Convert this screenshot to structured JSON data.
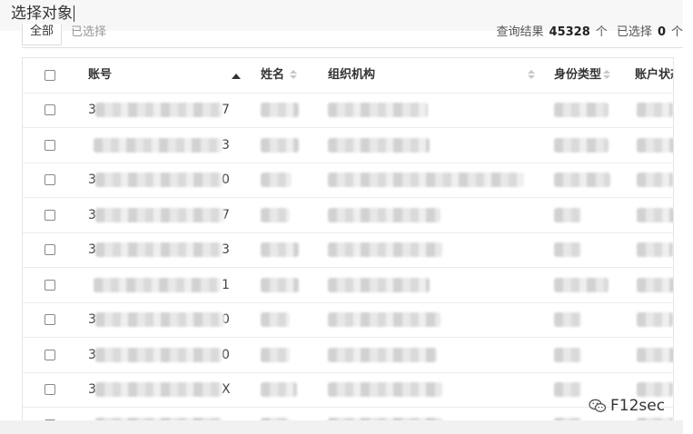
{
  "dialog": {
    "title": "选择对象"
  },
  "filter": {
    "tab_all": "全部",
    "selected_placeholder": "已选择",
    "result_label": "查询结果",
    "result_count": "45328",
    "unit": "个",
    "selected_label": "已选择",
    "selected_count": "0",
    "unit2": "个"
  },
  "table": {
    "columns": [
      "账号",
      "姓名",
      "组织机构",
      "身份类型",
      "账户状态"
    ],
    "rows": [
      {
        "account_lead": "3",
        "account_tail": "7"
      },
      {
        "account_lead": "",
        "account_tail": "3"
      },
      {
        "account_lead": "3",
        "account_tail": "0"
      },
      {
        "account_lead": "3",
        "account_tail": "7"
      },
      {
        "account_lead": "3",
        "account_tail": "3"
      },
      {
        "account_lead": "",
        "account_tail": "1"
      },
      {
        "account_lead": "3",
        "account_tail": "0"
      },
      {
        "account_lead": "3",
        "account_tail": "0"
      },
      {
        "account_lead": "3",
        "account_tail": "X"
      },
      {
        "account_lead": "",
        "account_tail": ""
      }
    ]
  },
  "watermark": {
    "text": "F12sec",
    "icon": "wechat-icon"
  }
}
